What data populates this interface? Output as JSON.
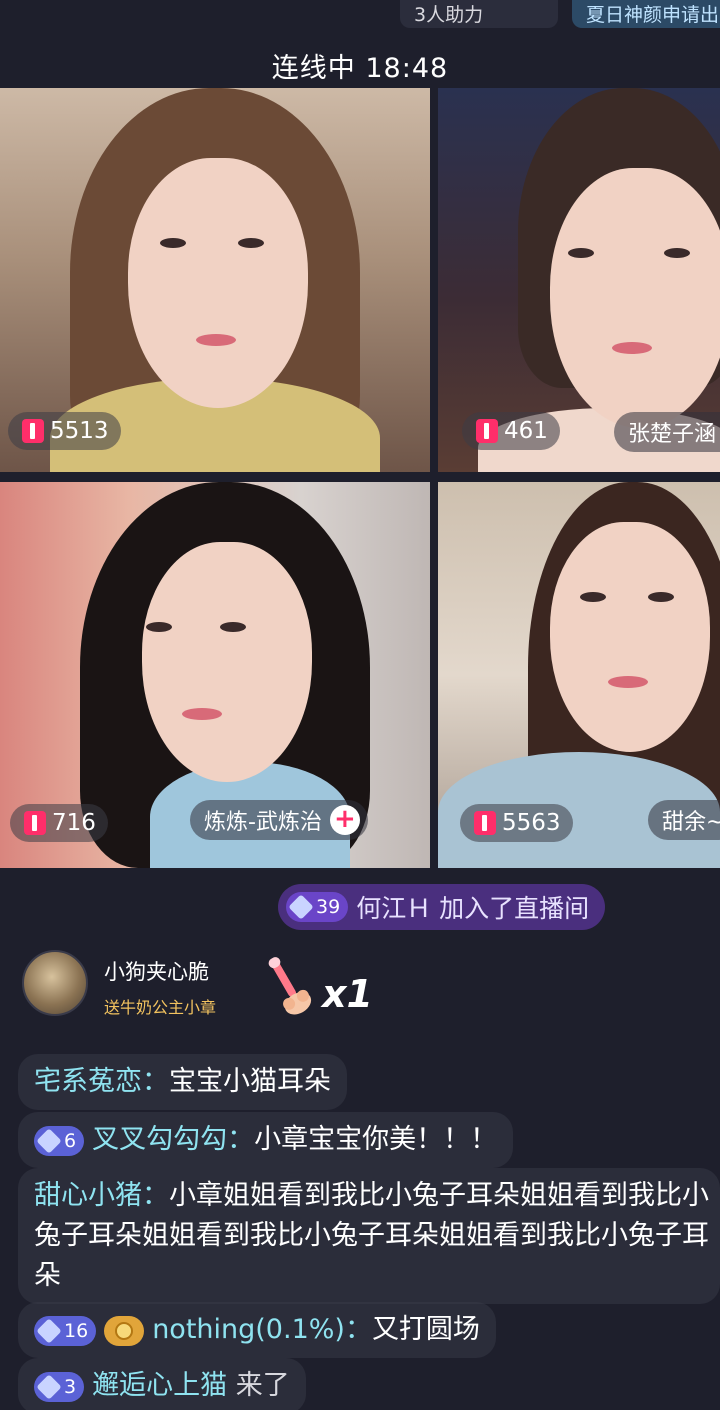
{
  "top": {
    "assist_text": "3人助力",
    "event_text": "夏日神颜申请出"
  },
  "status": "连线中 18:48",
  "tiles": [
    {
      "score": "5513",
      "name": ""
    },
    {
      "score": "461",
      "name": "张楚子涵"
    },
    {
      "score": "716",
      "name": "炼炼-武炼治"
    },
    {
      "score": "5563",
      "name": "甜余~"
    }
  ],
  "join": {
    "level": "39",
    "text": "何江Ｈ 加入了直播间"
  },
  "gift": {
    "user": "小狗夹心脆",
    "desc": "送牛奶公主小章",
    "count": "x1"
  },
  "messages": [
    {
      "nick": "宅系菟恋",
      "sep": "：",
      "text": "宝宝小猫耳朵"
    },
    {
      "level": "6",
      "nick": "叉叉勾勾勾",
      "sep": "：",
      "text": "小章宝宝你美！！！"
    },
    {
      "nick": "甜心小猪",
      "sep": "：",
      "text": "小章姐姐看到我比小兔子耳朵姐姐看到我比小兔子耳朵姐姐看到我比小兔子耳朵姐姐看到我比小兔子耳朵"
    },
    {
      "level": "16",
      "nick": "nothing(0.1%)",
      "sep": "：",
      "text": "又打圆场"
    },
    {
      "level": "3",
      "nick": "邂逅心上猫",
      "text": "来了"
    }
  ],
  "colors": {
    "background": "#1e1f2c",
    "accent_pink": "#ff2e6a",
    "nick_cyan": "#8fe3f0"
  }
}
